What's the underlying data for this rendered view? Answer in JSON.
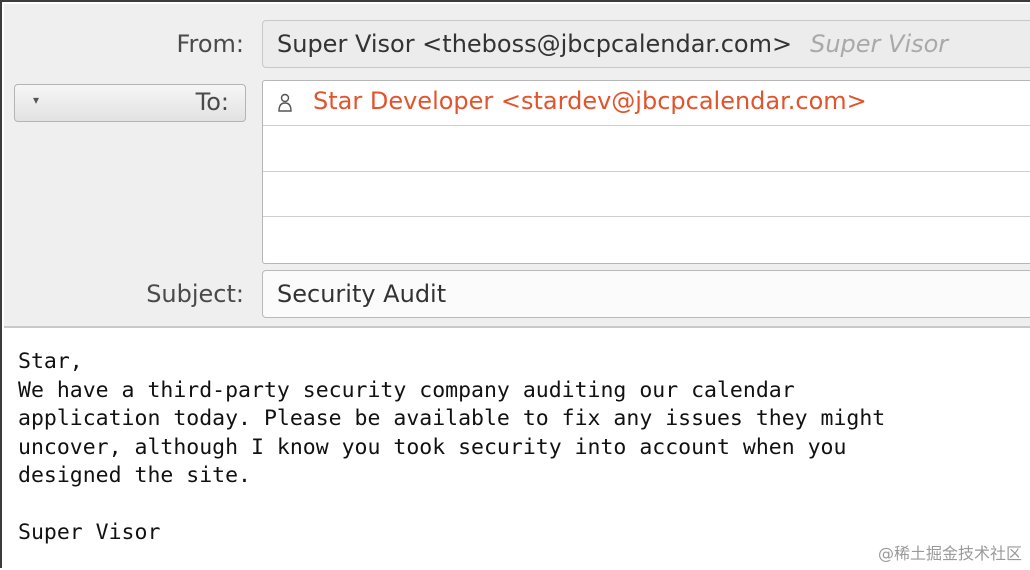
{
  "header": {
    "from_label": "From:",
    "from_value": "Super Visor <theboss@jbcpcalendar.com>",
    "from_identity_hint": "Super Visor",
    "to_label": "To:",
    "to_recipients": [
      "Star Developer <stardev@jbcpcalendar.com>"
    ],
    "subject_label": "Subject:",
    "subject_value": "Security Audit"
  },
  "body": {
    "lines": [
      "Star,",
      "We have a third-party security company auditing our calendar",
      "application today. Please be available to fix any issues they might",
      "uncover, although I know you took security into account when you",
      "designed the site.",
      "",
      "Super Visor"
    ]
  },
  "watermark": "@稀土掘金技术社区",
  "colors": {
    "recipient": "#e2542c",
    "header_bg": "#efefef"
  },
  "icons": {
    "recipient_icon": "person-icon",
    "to_dropdown_icon": "caret-down-icon"
  }
}
